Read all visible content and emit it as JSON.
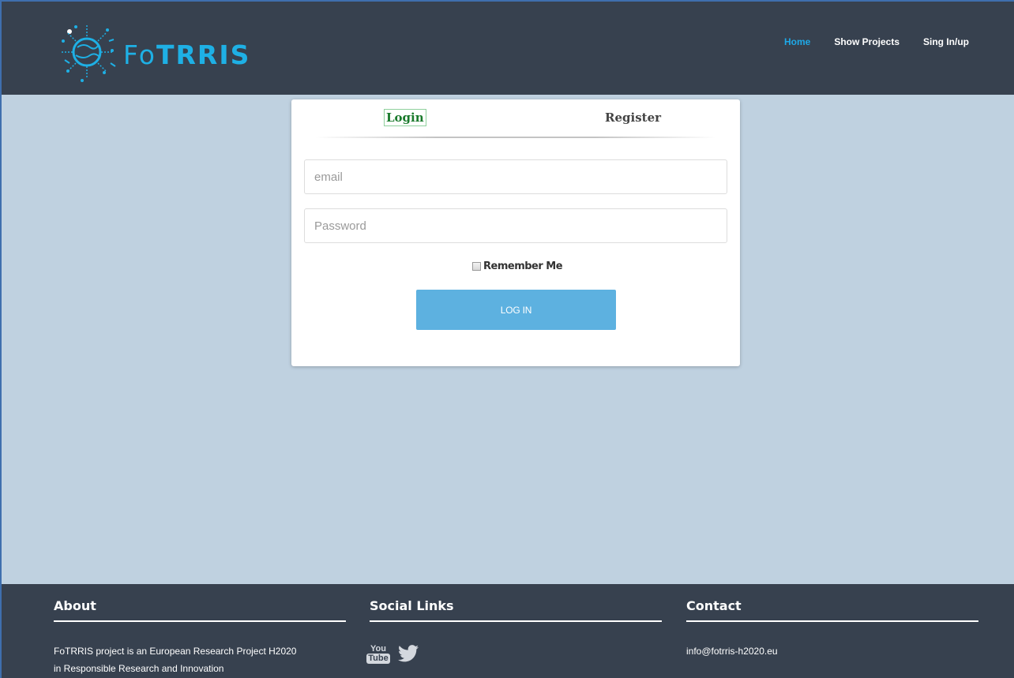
{
  "header": {
    "logo_text_regular": "Fo",
    "logo_text_bold": "TRRIS",
    "nav": {
      "home": "Home",
      "show_projects": "Show Projects",
      "sign_in_up": "Sing In/up"
    }
  },
  "login_card": {
    "tabs": {
      "login": "Login",
      "register": "Register"
    },
    "email_placeholder": "email",
    "password_placeholder": "Password",
    "remember_me": "Remember Me",
    "login_button": "LOG IN"
  },
  "footer": {
    "about": {
      "heading": "About",
      "text_line1": "FoTRRIS project is an European Research Project H2020",
      "text_line2": "in Responsible Research and Innovation"
    },
    "social": {
      "heading": "Social Links",
      "icons": [
        "youtube-icon",
        "twitter-icon"
      ],
      "youtube_top": "You",
      "youtube_bottom": "Tube"
    },
    "contact": {
      "heading": "Contact",
      "email": "info@fotrris-h2020.eu"
    }
  },
  "colors": {
    "header_bg": "#37414f",
    "page_bg": "#bfd1e0",
    "accent": "#1ea9e8",
    "login_tab": "#1a7a2c",
    "button": "#5db1e0"
  }
}
